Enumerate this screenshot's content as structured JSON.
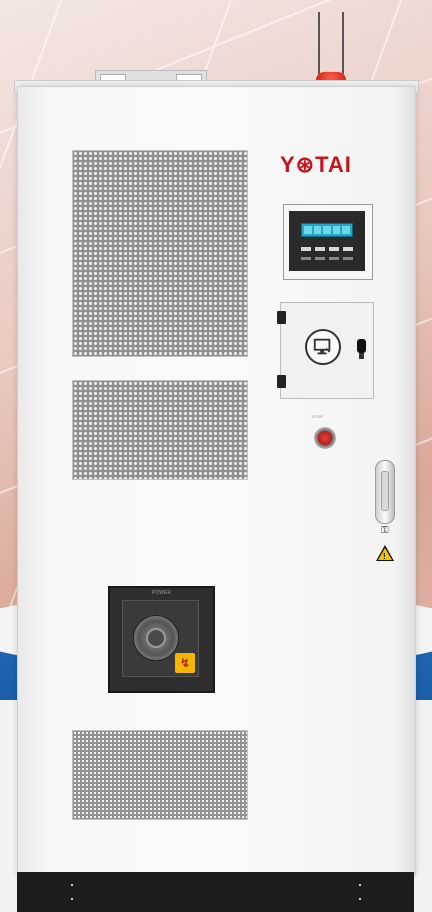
{
  "brand": {
    "logo_text": "Y⊛TAI",
    "logo_color": "#c4161c"
  },
  "display": {
    "title_text": "—"
  },
  "estop": {
    "label": "STOP"
  },
  "switch": {
    "label_text": "POWER",
    "tab_glyph": "↯"
  },
  "warning": {
    "mark": "!"
  },
  "icons": [
    "antenna-icon",
    "beacon-light-icon",
    "monitor-icon",
    "lock-knob-icon",
    "key-icon",
    "warning-triangle-icon",
    "rotary-switch-icon"
  ],
  "colors": {
    "background_blue": "#1f67b3",
    "beacon_red": "#d9261b",
    "estop_red": "#c0271f",
    "warning_yellow": "#f5c400",
    "lcd_blue": "#22a9c8"
  }
}
